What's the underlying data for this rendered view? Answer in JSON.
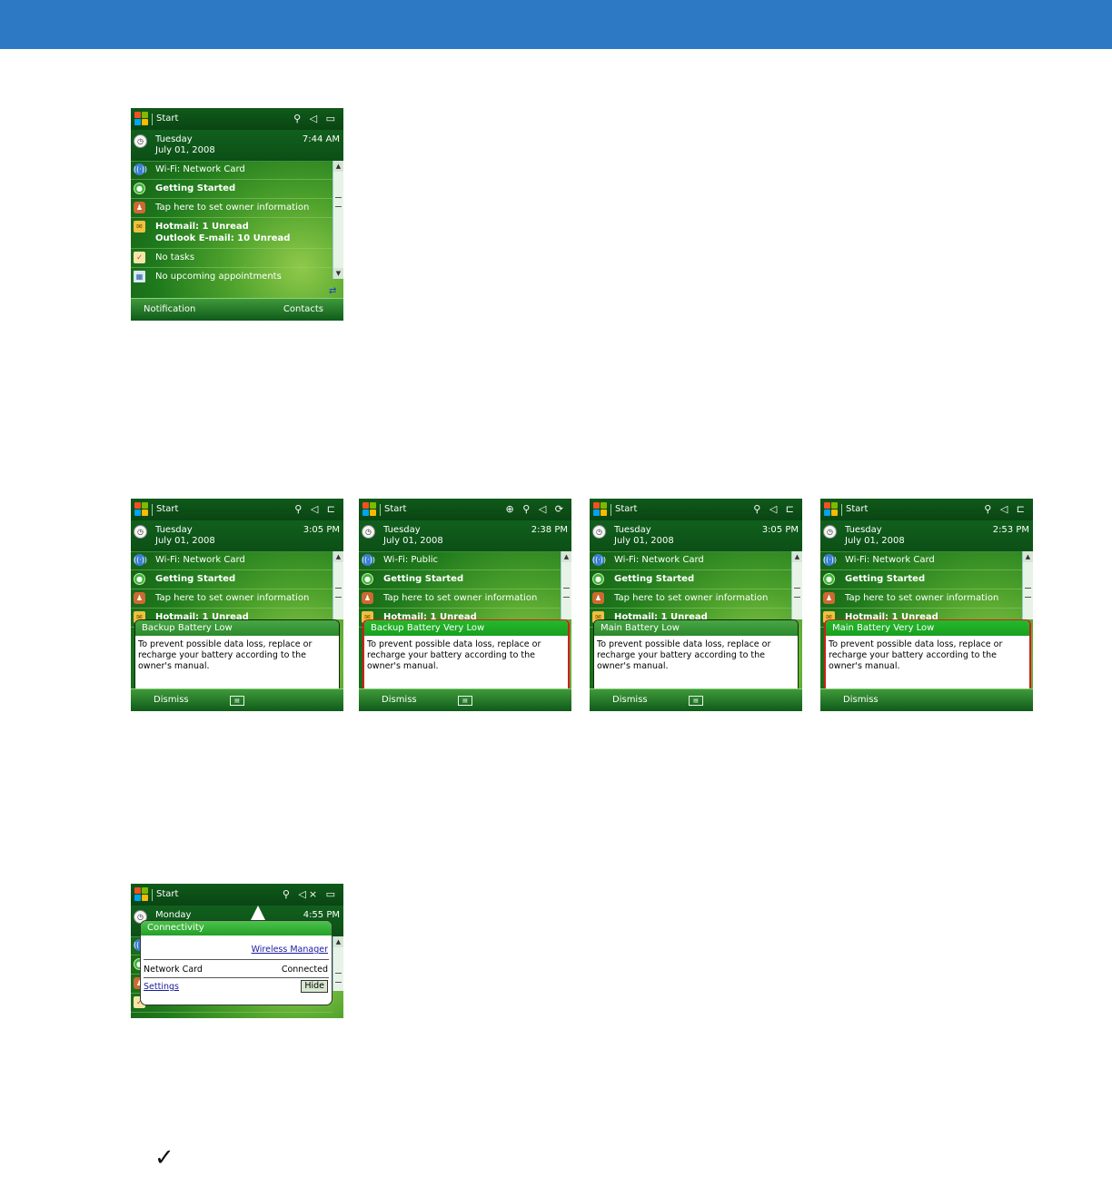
{
  "screens": {
    "today": {
      "title": "Start",
      "status": "⚲ ◁ ▭",
      "day": "Tuesday",
      "date": "July 01, 2008",
      "time": "7:44 AM",
      "items": [
        "Wi-Fi: Network Card",
        "Getting Started",
        "Tap here to set owner information",
        "Hotmail: 1 Unread",
        "Outlook E-mail: 10 Unread",
        "No tasks",
        "No upcoming appointments"
      ],
      "soft_left": "Notification",
      "soft_right": "Contacts"
    },
    "b1": {
      "title": "Start",
      "status": "⚲ ◁ ⊏",
      "day": "Tuesday",
      "date": "July 01, 2008",
      "time": "3:05 PM",
      "items": [
        "Wi-Fi: Network Card",
        "Getting Started",
        "Tap here to set owner information",
        "Hotmail: 1 Unread"
      ],
      "popup_title": "Backup Battery Low",
      "popup_body": "To prevent possible data loss, replace or recharge your battery according to the owner's manual.",
      "soft_left": "Dismiss"
    },
    "b2": {
      "title": "Start",
      "status": "⊕ ⚲ ◁ ⟳",
      "day": "Tuesday",
      "date": "July 01, 2008",
      "time": "2:38 PM",
      "items": [
        "Wi-Fi: Public",
        "Getting Started",
        "Tap here to set owner information",
        "Hotmail: 1 Unread"
      ],
      "popup_title": "Backup Battery Very Low",
      "popup_body": "To prevent possible data loss, replace or recharge your battery according to the owner's manual.",
      "soft_left": "Dismiss"
    },
    "b3": {
      "title": "Start",
      "status": "⚲ ◁ ⊏",
      "day": "Tuesday",
      "date": "July 01, 2008",
      "time": "3:05 PM",
      "items": [
        "Wi-Fi: Network Card",
        "Getting Started",
        "Tap here to set owner information",
        "Hotmail: 1 Unread"
      ],
      "popup_title": "Main Battery Low",
      "popup_body": "To prevent possible data loss, replace or recharge your battery according to the owner's manual.",
      "soft_left": "Dismiss"
    },
    "b4": {
      "title": "Start",
      "status": "⚲ ◁ ⊏",
      "day": "Tuesday",
      "date": "July 01, 2008",
      "time": "2:53 PM",
      "items": [
        "Wi-Fi: Network Card",
        "Getting Started",
        "Tap here to set owner information",
        "Hotmail: 1 Unread"
      ],
      "popup_title": "Main Battery Very Low",
      "popup_body": "To prevent possible data loss, replace or recharge your battery according to the owner's manual.",
      "soft_left": "Dismiss"
    },
    "conn": {
      "title": "Start",
      "status": "⚲ ◁× ▭",
      "day": "Monday",
      "time": "4:55 PM",
      "popup_title": "Connectivity",
      "wireless_manager": "Wireless Manager",
      "network_card": "Network Card",
      "connected": "Connected",
      "settings": "Settings",
      "hide": "Hide"
    }
  },
  "note_icon": "✓"
}
